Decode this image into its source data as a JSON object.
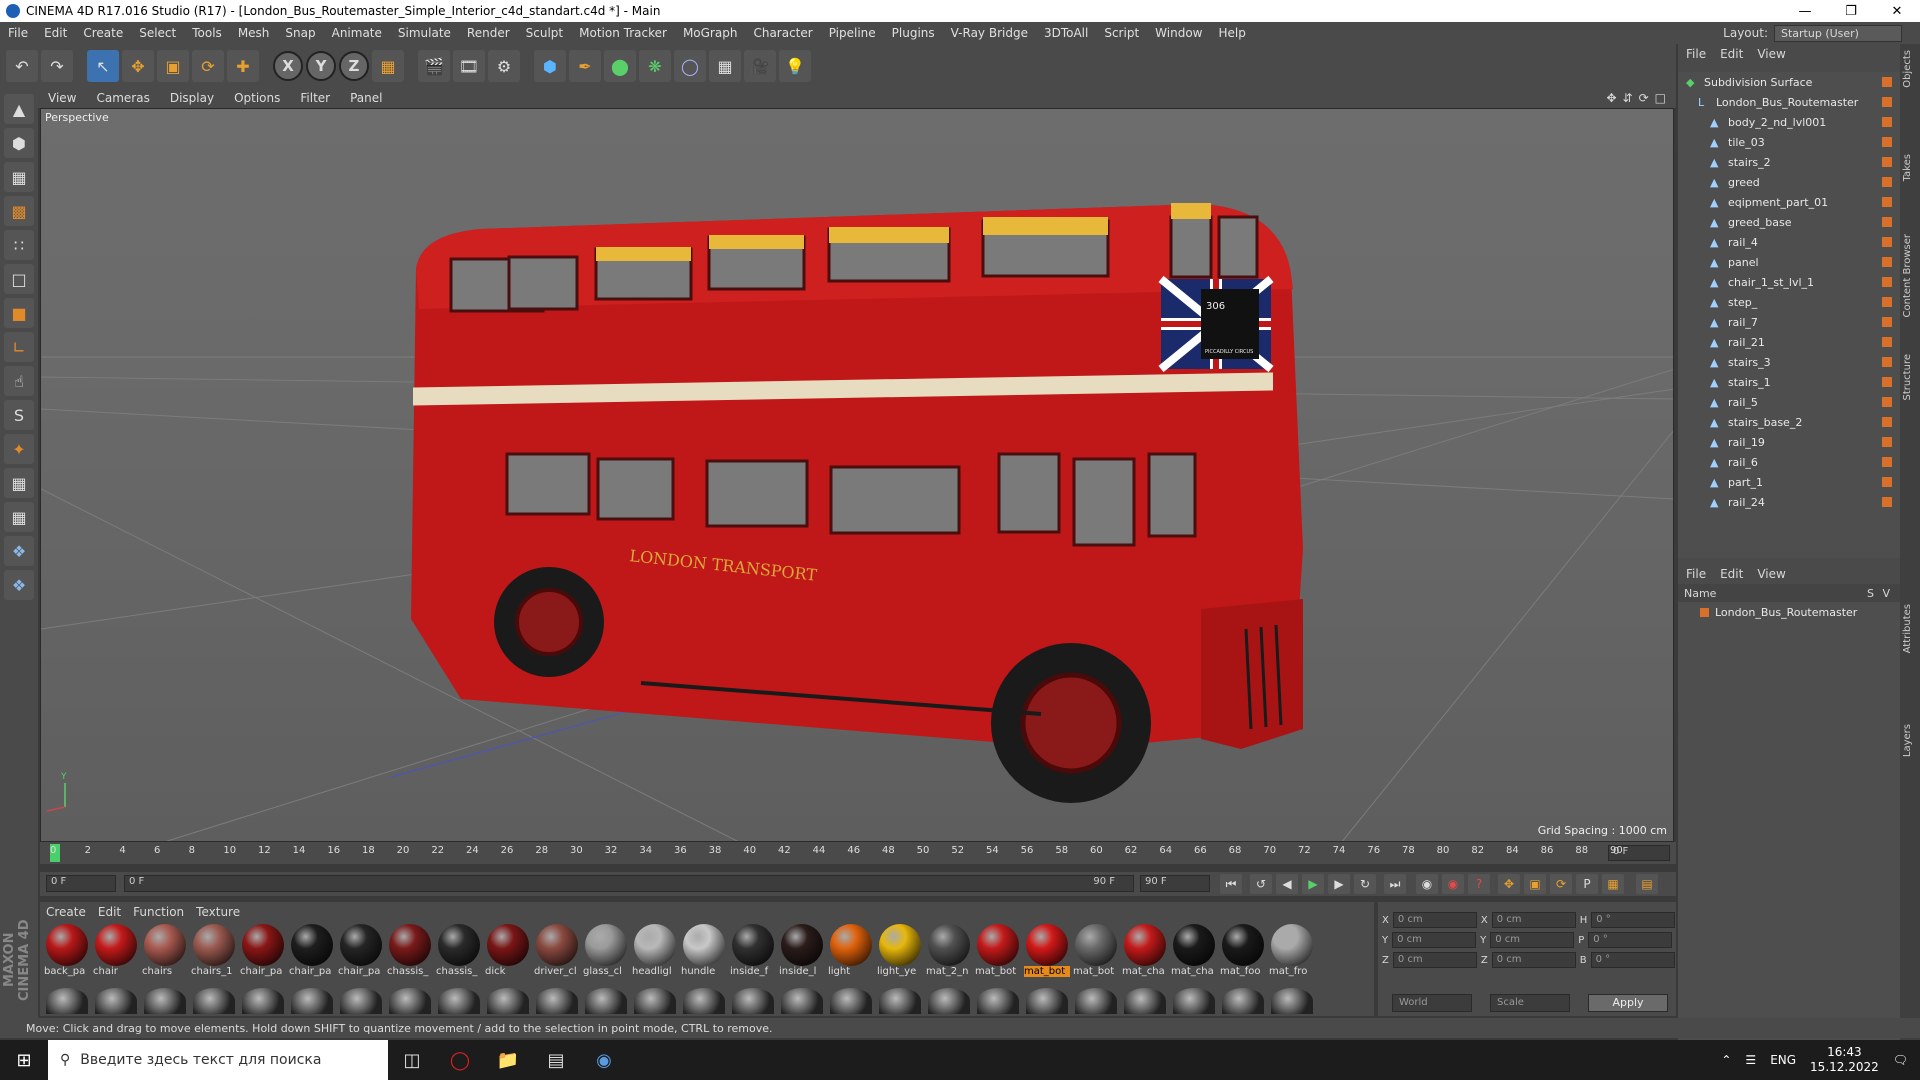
{
  "title": "CINEMA 4D R17.016 Studio (R17) - [London_Bus_Routemaster_Simple_Interior_c4d_standart.c4d *] - Main",
  "menus": [
    "File",
    "Edit",
    "Create",
    "Select",
    "Tools",
    "Mesh",
    "Snap",
    "Animate",
    "Simulate",
    "Render",
    "Sculpt",
    "Motion Tracker",
    "MoGraph",
    "Character",
    "Pipeline",
    "Plugins",
    "V-Ray Bridge",
    "3DToAll",
    "Script",
    "Window",
    "Help"
  ],
  "layout_label": "Layout:",
  "layout_value": "Startup (User)",
  "viewport_menu": [
    "View",
    "Cameras",
    "Display",
    "Options",
    "Filter",
    "Panel"
  ],
  "viewport_label": "Perspective",
  "grid_spacing": "Grid Spacing : 1000 cm",
  "timeline_ticks": [
    "0",
    "2",
    "4",
    "6",
    "8",
    "10",
    "12",
    "14",
    "16",
    "18",
    "20",
    "22",
    "24",
    "26",
    "28",
    "30",
    "32",
    "34",
    "36",
    "38",
    "40",
    "42",
    "44",
    "46",
    "48",
    "50",
    "52",
    "54",
    "56",
    "58",
    "60",
    "62",
    "64",
    "66",
    "68",
    "70",
    "72",
    "74",
    "76",
    "78",
    "80",
    "82",
    "84",
    "86",
    "88",
    "90"
  ],
  "current_frame": "0 F",
  "playback": {
    "start": "0 F",
    "start2": "0 F",
    "end": "90 F",
    "end2": "90 F"
  },
  "material_menu": [
    "Create",
    "Edit",
    "Function",
    "Texture"
  ],
  "materials": [
    {
      "name": "back_pa",
      "color": "#b81818"
    },
    {
      "name": "chair",
      "color": "#c41a1a"
    },
    {
      "name": "chairs",
      "color": "#a85a50"
    },
    {
      "name": "chairs_1",
      "color": "#9a5a50"
    },
    {
      "name": "chair_pa",
      "color": "#8a1616"
    },
    {
      "name": "chair_pa",
      "color": "#1e1e1e"
    },
    {
      "name": "chair_pa",
      "color": "#252525"
    },
    {
      "name": "chassis_",
      "color": "#7a1a1a"
    },
    {
      "name": "chassis_",
      "color": "#2a2a2a"
    },
    {
      "name": "dick",
      "color": "#7a1616"
    },
    {
      "name": "driver_cl",
      "color": "#8a4a40"
    },
    {
      "name": "glass_cl",
      "color": "#9a9a9a"
    },
    {
      "name": "headligl",
      "color": "#b8b8b8"
    },
    {
      "name": "hundle",
      "color": "#c8c8c8"
    },
    {
      "name": "inside_f",
      "color": "#303030"
    },
    {
      "name": "inside_l",
      "color": "#2a1c1a"
    },
    {
      "name": "light",
      "color": "#e0620c"
    },
    {
      "name": "light_ye",
      "color": "#e8b80c"
    },
    {
      "name": "mat_2_n",
      "color": "#505050"
    },
    {
      "name": "mat_bot",
      "color": "#c41a1a"
    },
    {
      "name": "mat_bot",
      "color": "#d21818",
      "selected": true
    },
    {
      "name": "mat_bot",
      "color": "#6a6a6a"
    },
    {
      "name": "mat_cha",
      "color": "#c41a1a"
    },
    {
      "name": "mat_cha",
      "color": "#1a1a1a"
    },
    {
      "name": "mat_foo",
      "color": "#1a1a1a"
    },
    {
      "name": "mat_fro",
      "color": "#aaaaaa"
    }
  ],
  "coords": {
    "rows": [
      {
        "a": "X",
        "v1": "0 cm",
        "b": "X",
        "v2": "0 cm",
        "c": "H",
        "v3": "0 °"
      },
      {
        "a": "Y",
        "v1": "0 cm",
        "b": "Y",
        "v2": "0 cm",
        "c": "P",
        "v3": "0 °"
      },
      {
        "a": "Z",
        "v1": "0 cm",
        "b": "Z",
        "v2": "0 cm",
        "c": "B",
        "v3": "0 °"
      }
    ],
    "world": "World",
    "scale": "Scale",
    "apply": "Apply"
  },
  "object_menu": [
    "File",
    "Edit",
    "View"
  ],
  "objects": [
    {
      "name": "Subdivision Surface",
      "indent": 0
    },
    {
      "name": "London_Bus_Routemaster",
      "indent": 1
    },
    {
      "name": "body_2_nd_lvl001",
      "indent": 2
    },
    {
      "name": "tile_03",
      "indent": 2
    },
    {
      "name": "stairs_2",
      "indent": 2
    },
    {
      "name": "greed",
      "indent": 2
    },
    {
      "name": "eqipment_part_01",
      "indent": 2
    },
    {
      "name": "greed_base",
      "indent": 2
    },
    {
      "name": "rail_4",
      "indent": 2
    },
    {
      "name": "panel",
      "indent": 2
    },
    {
      "name": "chair_1_st_lvl_1",
      "indent": 2
    },
    {
      "name": "step_",
      "indent": 2
    },
    {
      "name": "rail_7",
      "indent": 2
    },
    {
      "name": "rail_21",
      "indent": 2
    },
    {
      "name": "stairs_3",
      "indent": 2
    },
    {
      "name": "stairs_1",
      "indent": 2
    },
    {
      "name": "rail_5",
      "indent": 2
    },
    {
      "name": "stairs_base_2",
      "indent": 2
    },
    {
      "name": "rail_19",
      "indent": 2
    },
    {
      "name": "rail_6",
      "indent": 2
    },
    {
      "name": "part_1",
      "indent": 2
    },
    {
      "name": "rail_24",
      "indent": 2
    }
  ],
  "layer_menu": [
    "File",
    "Edit",
    "View"
  ],
  "layer_header": {
    "name": "Name",
    "s": "S",
    "v": "V"
  },
  "layers": [
    "London_Bus_Routemaster"
  ],
  "side_tabs": [
    "Objects",
    "Takes",
    "Content Browser",
    "Structure",
    "Attributes",
    "Layers"
  ],
  "status": "Move: Click and drag to move elements. Hold down SHIFT to quantize movement / add to the selection in point mode, CTRL to remove.",
  "taskbar": {
    "search": "Введите здесь текст для поиска",
    "lang": "ENG",
    "time": "16:43",
    "date": "15.12.2022"
  },
  "bus": {
    "route": "306",
    "dest": "PICCADILLY CIRCUS",
    "side_text": "LONDON TRANSPORT",
    "color": "#c01818"
  },
  "brand_vertical": "MAXON CINEMA 4D"
}
